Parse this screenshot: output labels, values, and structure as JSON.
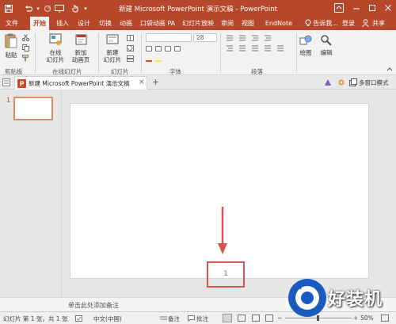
{
  "titlebar": {
    "title": "新建 Microsoft PowerPoint 演示文稿 - PowerPoint"
  },
  "tabs": [
    {
      "label": "文件"
    },
    {
      "label": "开始"
    },
    {
      "label": "插入"
    },
    {
      "label": "设计"
    },
    {
      "label": "切换"
    },
    {
      "label": "动画"
    },
    {
      "label": "口袋动画 PA"
    },
    {
      "label": "幻灯片放映"
    },
    {
      "label": "审阅"
    },
    {
      "label": "视图"
    },
    {
      "label": "EndNote X8"
    },
    {
      "label": "告诉我..."
    },
    {
      "label": "登录"
    },
    {
      "label": "共享"
    }
  ],
  "ribbon": {
    "paste": "粘贴",
    "online_slides_1": "在线",
    "online_slides_2": "幻灯片",
    "new_anim_page_1": "新加",
    "new_anim_page_2": "动画页",
    "new_slide_1": "新建",
    "new_slide_2": "幻灯片",
    "font_size": "28",
    "draw": "绘图",
    "edit": "编辑",
    "groups": {
      "clipboard": "剪贴板",
      "online_slides": "在线幻灯片",
      "slides": "幻灯片",
      "font": "字体",
      "paragraph": "段落"
    }
  },
  "doc_tab": {
    "title": "新建 Microsoft PowerPoint 演示文稿",
    "close": "×",
    "add": "+"
  },
  "doc_right": {
    "multi_window": "多窗口模式"
  },
  "slides": {
    "thumb_number": "1",
    "page_number": "1"
  },
  "notes": {
    "placeholder": "单击此处添加备注"
  },
  "status": {
    "slide_info": "幻灯片 第 1 张，共 1 张",
    "language": "中文(中国)",
    "notes_btn": "备注",
    "comments_btn": "批注",
    "zoom": "50%"
  },
  "watermark": {
    "text": "好装机"
  },
  "colors": {
    "accent": "#b7472a",
    "marker": "#d9534f"
  }
}
